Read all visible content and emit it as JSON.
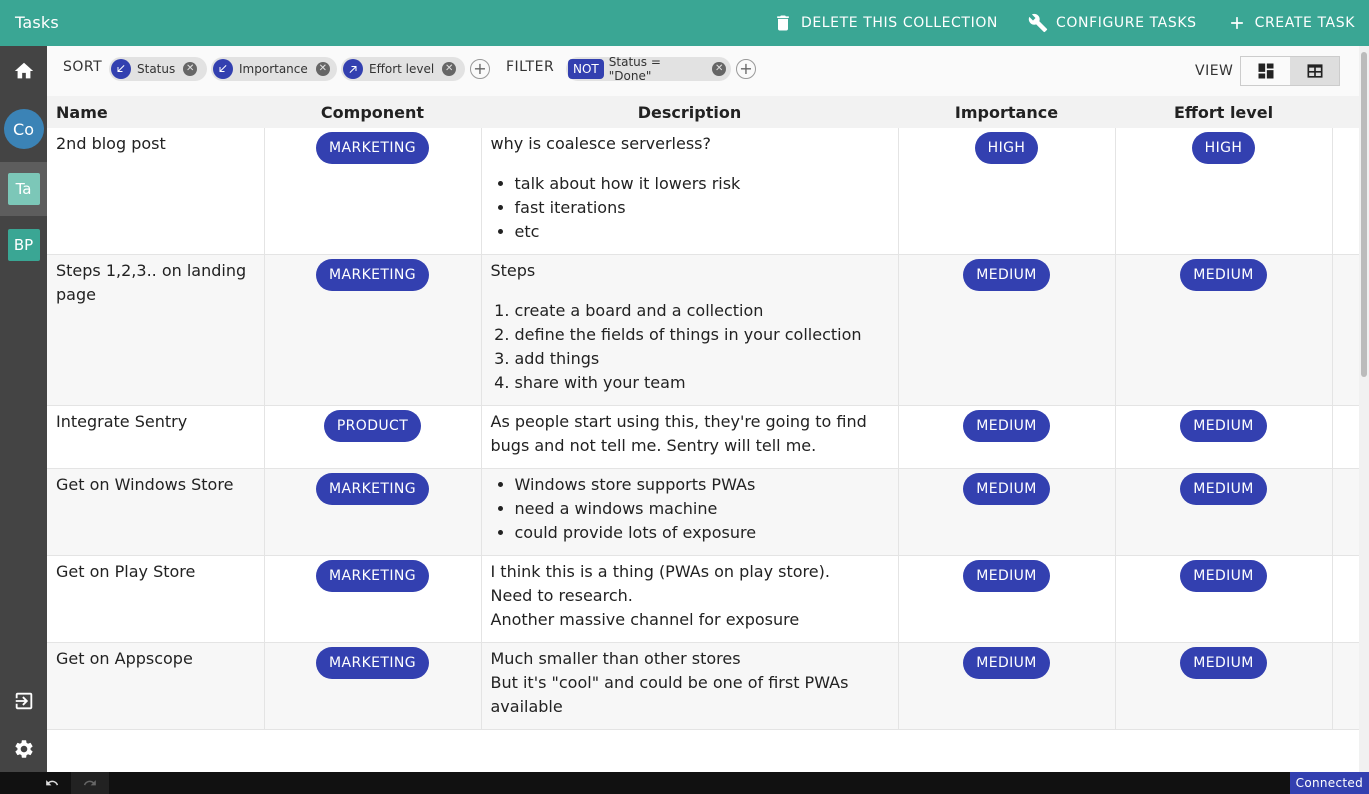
{
  "app": {
    "title": "Tasks"
  },
  "header": {
    "actions": [
      {
        "label": "DELETE THIS COLLECTION",
        "icon": "trash-icon"
      },
      {
        "label": "CONFIGURE TASKS",
        "icon": "wrench-icon"
      },
      {
        "label": "CREATE TASK",
        "icon": "plus-icon"
      }
    ]
  },
  "sidebar": {
    "items": [
      {
        "label": "",
        "icon": "home-icon"
      },
      {
        "label": "Co",
        "icon": "avatar"
      },
      {
        "label": "Ta",
        "icon": "avatar",
        "active": true
      },
      {
        "label": "BP",
        "icon": "avatar"
      }
    ],
    "bottom": [
      {
        "icon": "logout-icon"
      },
      {
        "icon": "gear-icon"
      }
    ]
  },
  "toolbar": {
    "sort_label": "SORT",
    "sorts": [
      {
        "label": "Status",
        "direction": "descending"
      },
      {
        "label": "Importance",
        "direction": "descending"
      },
      {
        "label": "Effort level",
        "direction": "ascending"
      }
    ],
    "filter_label": "FILTER",
    "filters": [
      {
        "negation": "NOT",
        "label": "Status = \"Done\""
      }
    ],
    "view_label": "VIEW",
    "view_options": [
      {
        "icon": "board-view-icon"
      },
      {
        "icon": "table-view-icon",
        "selected": true
      }
    ]
  },
  "table": {
    "columns": [
      "Name",
      "Component",
      "Description",
      "Importance",
      "Effort level"
    ],
    "rows": [
      {
        "name": "2nd blog post",
        "component": "MARKETING",
        "importance": "HIGH",
        "effort": "HIGH",
        "desc_text": [
          "why is coalesce serverless?"
        ],
        "desc_list_type": "ul",
        "desc_list": [
          "talk about how it lowers risk",
          "fast iterations",
          "etc"
        ]
      },
      {
        "name": "Steps 1,2,3.. on landing page",
        "component": "MARKETING",
        "importance": "MEDIUM",
        "effort": "MEDIUM",
        "desc_text": [
          "Steps"
        ],
        "desc_list_type": "ol",
        "desc_list": [
          "create a board and a collection",
          "define the fields of things in your collection",
          "add things",
          "share with your team"
        ]
      },
      {
        "name": "Integrate Sentry",
        "component": "PRODUCT",
        "importance": "MEDIUM",
        "effort": "MEDIUM",
        "desc_text": [
          "As people start using this, they're going to find bugs and not tell me. Sentry will tell me."
        ],
        "desc_list_type": "",
        "desc_list": []
      },
      {
        "name": "Get on Windows Store",
        "component": "MARKETING",
        "importance": "MEDIUM",
        "effort": "MEDIUM",
        "desc_text": [],
        "desc_list_type": "ul",
        "desc_list": [
          "Windows store supports PWAs",
          "need a windows machine",
          "could provide lots of exposure"
        ]
      },
      {
        "name": "Get on Play Store",
        "component": "MARKETING",
        "importance": "MEDIUM",
        "effort": "MEDIUM",
        "desc_text": [
          "I think this is a thing (PWAs on play store).",
          "Need to research.",
          "Another massive channel for exposure"
        ],
        "desc_list_type": "",
        "desc_list": []
      },
      {
        "name": "Get on Appscope",
        "component": "MARKETING",
        "importance": "MEDIUM",
        "effort": "MEDIUM",
        "desc_text": [
          "Much smaller than other stores",
          "But it's \"cool\" and could be one of first PWAs available"
        ],
        "desc_list_type": "",
        "desc_list": []
      }
    ]
  },
  "status": {
    "connection": "Connected"
  },
  "colors": {
    "accent": "#3aa694",
    "pill": "#3340b0",
    "sidebar": "#444444"
  }
}
